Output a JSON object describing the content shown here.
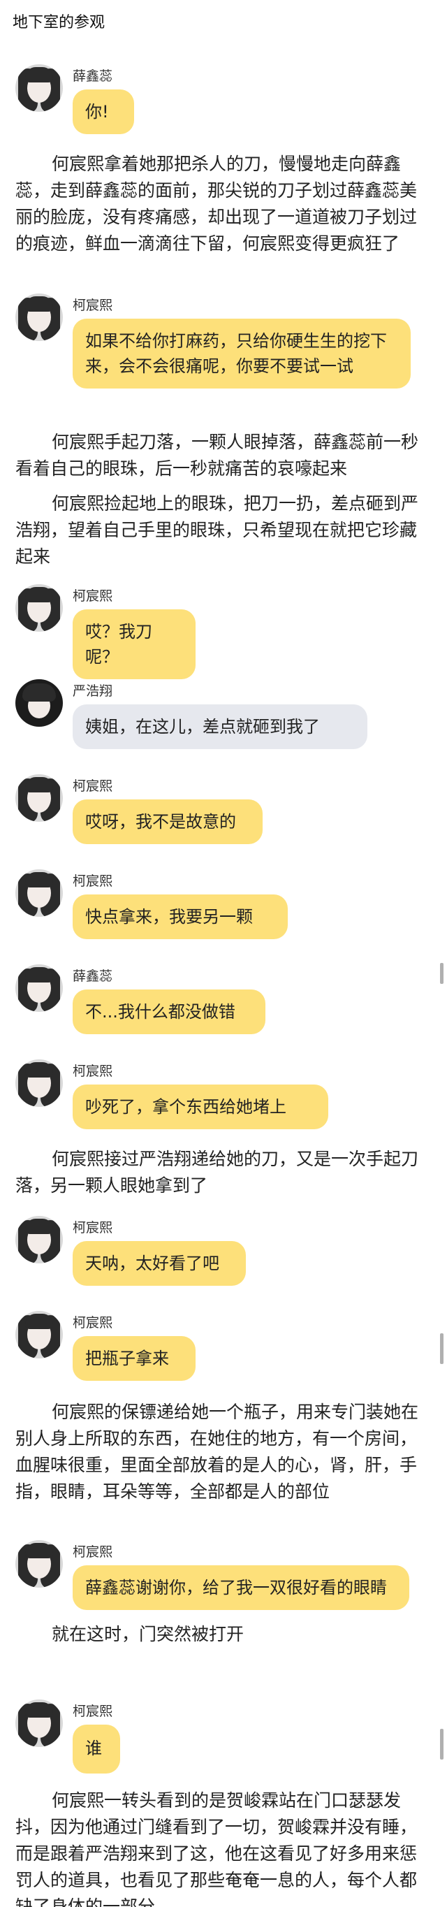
{
  "page_title": "地下室的参观",
  "colors": {
    "bubble": "#fde07a",
    "bubble_alt": "#e6e8ee"
  },
  "feed": [
    {
      "kind": "msg",
      "name": "薛鑫蕊",
      "text": "你!",
      "bubble": "yellow"
    },
    {
      "kind": "nar",
      "text": "何宸熙拿着她那把杀人的刀，慢慢地走向薛鑫蕊，走到薛鑫蕊的面前，那尖锐的刀子划过薛鑫蕊美丽的脸庞，没有疼痛感，却出现了一道道被刀子划过的痕迹，鲜血一滴滴往下留，何宸熙变得更疯狂了"
    },
    {
      "kind": "msg",
      "name": "柯宸熙",
      "text": "如果不给你打麻药，只给你硬生生的挖下来，会不会很痛呢，你要不要试一试",
      "bubble": "yellow"
    },
    {
      "kind": "nar",
      "text": "何宸熙手起刀落，一颗人眼掉落，薛鑫蕊前一秒看着自己的眼珠，后一秒就痛苦的哀嚎起来"
    },
    {
      "kind": "nar",
      "text": "何宸熙捡起地上的眼珠，把刀一扔，差点砸到严浩翔，望着自己手里的眼珠，只希望现在就把它珍藏起来"
    },
    {
      "kind": "msg",
      "name": "柯宸熙",
      "text": "哎？我刀呢？",
      "bubble": "yellow"
    },
    {
      "kind": "msg",
      "name": "严浩翔",
      "text": "姨姐，在这儿，差点就砸到我了",
      "bubble": "gray"
    },
    {
      "kind": "msg",
      "name": "柯宸熙",
      "text": "哎呀，我不是故意的",
      "bubble": "yellow"
    },
    {
      "kind": "msg",
      "name": "柯宸熙",
      "text": "快点拿来，我要另一颗",
      "bubble": "yellow"
    },
    {
      "kind": "msg",
      "name": "薛鑫蕊",
      "text": "不...我什么都没做错",
      "bubble": "yellow"
    },
    {
      "kind": "msg",
      "name": "柯宸熙",
      "text": "吵死了，拿个东西给她堵上",
      "bubble": "yellow"
    },
    {
      "kind": "nar",
      "text": "何宸熙接过严浩翔递给她的刀，又是一次手起刀落，另一颗人眼她拿到了"
    },
    {
      "kind": "msg",
      "name": "柯宸熙",
      "text": "天呐，太好看了吧",
      "bubble": "yellow"
    },
    {
      "kind": "msg",
      "name": "柯宸熙",
      "text": "把瓶子拿来",
      "bubble": "yellow"
    },
    {
      "kind": "nar",
      "text": "何宸熙的保镖递给她一个瓶子，用来专门装她在别人身上所取的东西，在她住的地方，有一个房间，血腥味很重，里面全部放着的是人的心，肾，肝，手指，眼睛，耳朵等等，全部都是人的部位"
    },
    {
      "kind": "msg",
      "name": "柯宸熙",
      "text": "薛鑫蕊谢谢你，给了我一双很好看的眼睛",
      "bubble": "yellow"
    },
    {
      "kind": "nar",
      "text": "就在这时，门突然被打开"
    },
    {
      "kind": "msg",
      "name": "柯宸熙",
      "text": "谁",
      "bubble": "yellow"
    },
    {
      "kind": "nar",
      "text": "何宸熙一转头看到的是贺峻霖站在门口瑟瑟发抖，因为他通过门缝看到了一切，贺峻霖并没有睡，而是跟着严浩翔来到了这，他在这看见了好多用来惩罚人的道具，也看见了那些奄奄一息的人，每个人都缺了身体的一部分"
    }
  ]
}
